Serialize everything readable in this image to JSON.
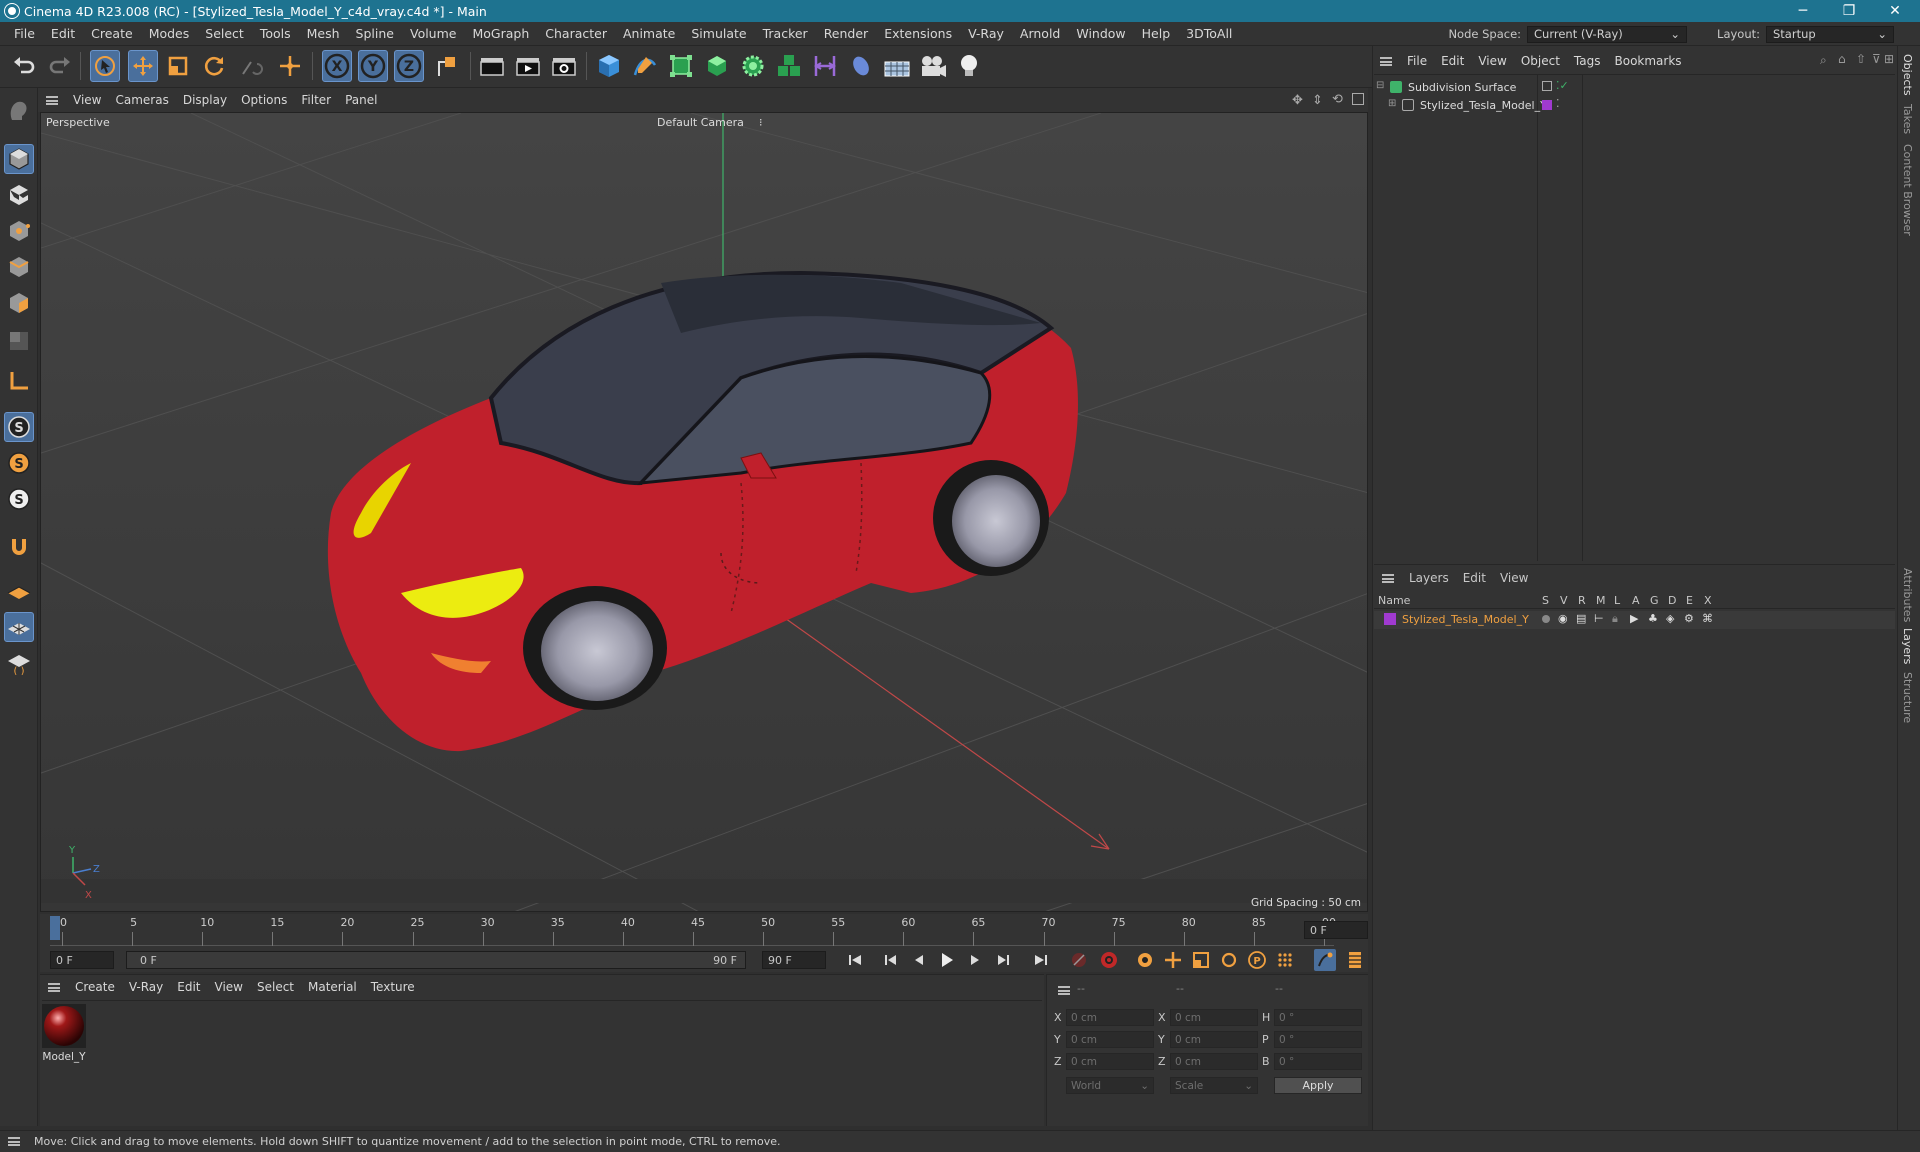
{
  "window": {
    "title": "Cinema 4D R23.008 (RC) - [Stylized_Tesla_Model_Y_c4d_vray.c4d *] - Main",
    "minimize": "─",
    "restore": "❐",
    "close": "✕"
  },
  "menu": {
    "items": [
      "File",
      "Edit",
      "Create",
      "Modes",
      "Select",
      "Tools",
      "Mesh",
      "Spline",
      "Volume",
      "MoGraph",
      "Character",
      "Animate",
      "Simulate",
      "Tracker",
      "Render",
      "Extensions",
      "V-Ray",
      "Arnold",
      "Window",
      "Help",
      "3DToAll"
    ],
    "node_space_label": "Node Space:",
    "node_space_value": "Current (V-Ray)",
    "layout_label": "Layout:",
    "layout_value": "Startup"
  },
  "toolbar": {
    "axis_x": "X",
    "axis_y": "Y",
    "axis_z": "Z"
  },
  "viewport": {
    "menu": [
      "View",
      "Cameras",
      "Display",
      "Options",
      "Filter",
      "Panel"
    ],
    "label": "Perspective",
    "camera": "Default Camera",
    "grid_spacing": "Grid Spacing : 50 cm",
    "axis_y": "Y",
    "axis_z": "Z",
    "axis_x": "X"
  },
  "timeline": {
    "ticks": [
      "0",
      "5",
      "10",
      "15",
      "20",
      "25",
      "30",
      "35",
      "40",
      "45",
      "50",
      "55",
      "60",
      "65",
      "70",
      "75",
      "80",
      "85",
      "90"
    ],
    "current_frame": "0 F"
  },
  "playback": {
    "start": "0 F",
    "range_start": "0 F",
    "range_end": "90 F",
    "end": "90 F"
  },
  "material_manager": {
    "menu": [
      "Create",
      "V-Ray",
      "Edit",
      "View",
      "Select",
      "Material",
      "Texture"
    ],
    "material_name": "Model_Y"
  },
  "coordinates": {
    "header": [
      "--",
      "--",
      "--"
    ],
    "rows": [
      {
        "label": "X",
        "pos": "0 cm",
        "label2": "X",
        "size": "0 cm",
        "label3": "H",
        "rot": "0 °"
      },
      {
        "label": "Y",
        "pos": "0 cm",
        "label2": "Y",
        "size": "0 cm",
        "label3": "P",
        "rot": "0 °"
      },
      {
        "label": "Z",
        "pos": "0 cm",
        "label2": "Z",
        "size": "0 cm",
        "label3": "B",
        "rot": "0 °"
      }
    ],
    "mode": "World",
    "scale": "Scale",
    "apply": "Apply"
  },
  "object_manager": {
    "menu": [
      "File",
      "Edit",
      "View",
      "Object",
      "Tags",
      "Bookmarks"
    ],
    "objects": [
      {
        "name": "Subdivision Surface"
      },
      {
        "name": "Stylized_Tesla_Model_Y"
      }
    ]
  },
  "layer_manager": {
    "menu": [
      "Layers",
      "Edit",
      "View"
    ],
    "columns": [
      "Name",
      "S",
      "V",
      "R",
      "M",
      "L",
      "A",
      "G",
      "D",
      "E",
      "X"
    ],
    "layer_name": "Stylized_Tesla_Model_Y",
    "layer_color": "#a03ad0"
  },
  "side_tabs": [
    "Objects",
    "Takes",
    "Content Browser",
    "Attributes",
    "Layers",
    "Structure"
  ],
  "status": "Move: Click and drag to move elements. Hold down SHIFT to quantize movement / add to the selection in point mode, CTRL to remove.",
  "colors": {
    "titlebar": "#1e7390",
    "accent": "#4a6f9c",
    "car_body": "#c0202c",
    "highlight_orange": "#f0a040"
  }
}
